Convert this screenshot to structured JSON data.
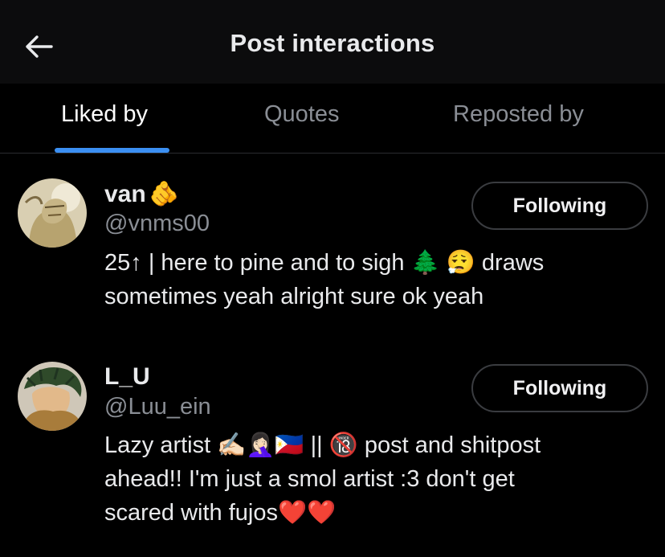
{
  "header": {
    "title": "Post interactions",
    "back_icon": "arrow-left-icon"
  },
  "tabs": [
    {
      "label": "Liked by",
      "active": true
    },
    {
      "label": "Quotes",
      "active": false
    },
    {
      "label": "Reposted by",
      "active": false
    }
  ],
  "users": [
    {
      "name": "van",
      "name_emoji": "🫵",
      "handle": "@vnms00",
      "bio_line1": "25↑ | here to pine and to sigh 🌲 😮‍💨 draws",
      "bio_line2": "sometimes yeah alright sure ok yeah",
      "follow_label": "Following",
      "avatar_icon": "avatar-illustration"
    },
    {
      "name": "L_U",
      "handle": "@Luu_ein",
      "bio_line1": "Lazy artist ✍🏻🤦🏻‍♀️🇵🇭 || 🔞 post and shitpost",
      "bio_line2": "ahead!! I'm just a smol artist :3 don't get",
      "bio_line3": "scared with fujos❤️❤️",
      "follow_label": "Following",
      "avatar_icon": "avatar-illustration"
    }
  ],
  "colors": {
    "background": "#000000",
    "header_bg": "#0c0c0d",
    "accent": "#3b8ff2",
    "muted_text": "#8a8e95"
  }
}
